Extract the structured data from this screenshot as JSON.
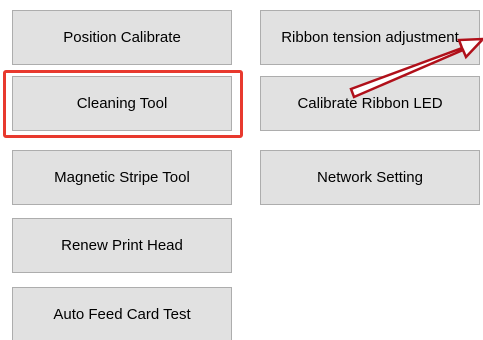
{
  "buttons": {
    "position_calibrate": "Position Calibrate",
    "cleaning_tool": "Cleaning Tool",
    "magnetic_stripe_tool": "Magnetic Stripe Tool",
    "renew_print_head": "Renew Print Head",
    "auto_feed_card_test": "Auto Feed Card Test",
    "ribbon_tension_adjustment": "Ribbon tension adjustment",
    "calibrate_ribbon_led": "Calibrate Ribbon LED",
    "network_setting": "Network Setting"
  },
  "colors": {
    "button_face": "#e1e1e1",
    "button_border": "#adadad",
    "highlight": "#e8392e",
    "arrow_stroke": "#b0101a",
    "arrow_fill": "#ffffff"
  },
  "annotations": {
    "highlight_target": "Cleaning Tool",
    "arrow_target": "Ribbon tension adjustment"
  }
}
